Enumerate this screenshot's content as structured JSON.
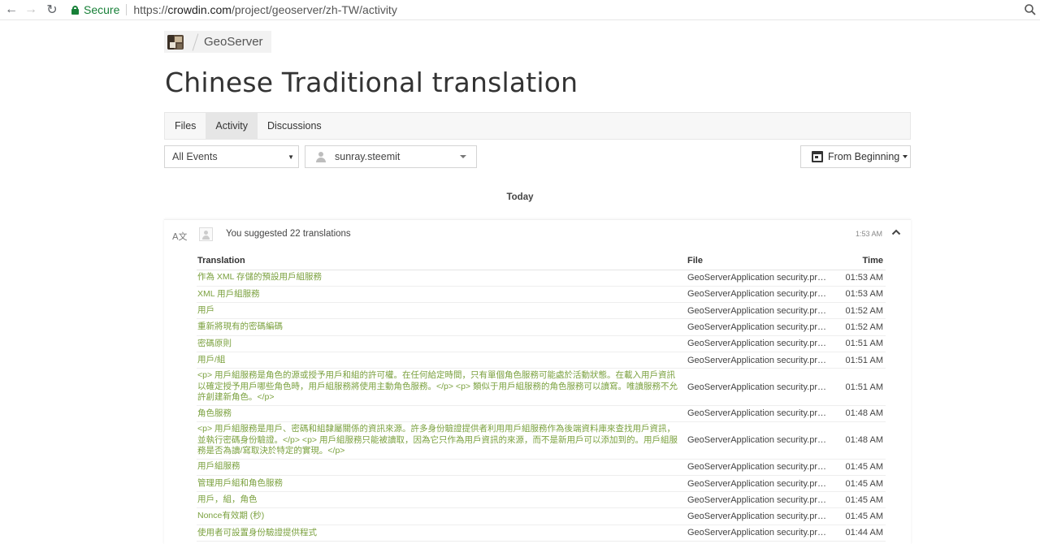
{
  "browser": {
    "secure_label": "Secure",
    "url_scheme": "https://",
    "url_host": "crowdin.com",
    "url_path": "/project/geoserver/zh-TW/activity"
  },
  "breadcrumb": {
    "project_name": "GeoServer"
  },
  "page": {
    "title": "Chinese Traditional translation"
  },
  "tabs": [
    {
      "label": "Files",
      "active": false
    },
    {
      "label": "Activity",
      "active": true
    },
    {
      "label": "Discussions",
      "active": false
    }
  ],
  "filters": {
    "event_type": "All Events",
    "user": "sunray.steemit",
    "date_range": "From Beginning"
  },
  "day_label": "Today",
  "activity": {
    "summary": "You suggested 22 translations",
    "time": "1:53 AM",
    "columns": {
      "translation": "Translation",
      "file": "File",
      "time": "Time"
    },
    "rows": [
      {
        "translation": "作為 XML 存儲的預設用戶組服務",
        "file": "GeoServerApplication security.properties",
        "time": "01:53 AM"
      },
      {
        "translation": "XML 用戶組服務",
        "file": "GeoServerApplication security.properties",
        "time": "01:53 AM"
      },
      {
        "translation": "用戶",
        "file": "GeoServerApplication security.properties",
        "time": "01:52 AM"
      },
      {
        "translation": "重新將現有的密碼編碼",
        "file": "GeoServerApplication security.properties",
        "time": "01:52 AM"
      },
      {
        "translation": "密碼原則",
        "file": "GeoServerApplication security.properties",
        "time": "01:51 AM"
      },
      {
        "translation": "用戶/組",
        "file": "GeoServerApplication security.properties",
        "time": "01:51 AM"
      },
      {
        "translation": "<p> 用戶組服務是角色的源或授予用戶和組的許可權。在任何給定時間，只有單個角色服務可能處於活動狀態。在載入用戶資訊以確定授予用戶哪些角色時，用戶組服務將使用主動角色服務。</p> <p> 類似于用戶組服務的角色服務可以讀寫。唯讀服務不允許創建新角色。</p>",
        "file": "GeoServerApplication security.properties",
        "time": "01:51 AM"
      },
      {
        "translation": "角色服務",
        "file": "GeoServerApplication security.properties",
        "time": "01:48 AM"
      },
      {
        "translation": "<p> 用戶組服務是用戶、密碼和組隸屬關係的資訊來源。許多身份驗證提供者利用用戶組服務作為後端資料庫來查找用戶資訊，並執行密碼身份驗證。</p> <p> 用戶組服務只能被讀取，因為它只作為用戶資訊的來源，而不是新用戶可以添加到的。用戶組服務是否為讀/寫取決於特定的實現。</p>",
        "file": "GeoServerApplication security.properties",
        "time": "01:48 AM"
      },
      {
        "translation": "用戶組服務",
        "file": "GeoServerApplication security.properties",
        "time": "01:45 AM"
      },
      {
        "translation": "管理用戶組和角色服務",
        "file": "GeoServerApplication security.properties",
        "time": "01:45 AM"
      },
      {
        "translation": "用戶，組，角色",
        "file": "GeoServerApplication security.properties",
        "time": "01:45 AM"
      },
      {
        "translation": "Nonce有效期 (秒)",
        "file": "GeoServerApplication security.properties",
        "time": "01:45 AM"
      },
      {
        "translation": "使用者可設置身份驗證提供程式",
        "file": "GeoServerApplication security.properties",
        "time": "01:44 AM"
      }
    ]
  }
}
